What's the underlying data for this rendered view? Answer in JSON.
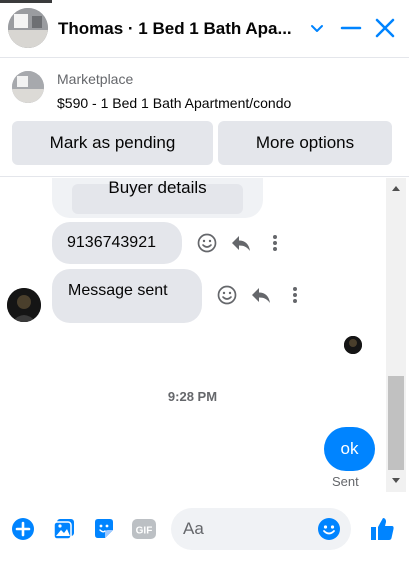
{
  "header": {
    "title": "Thomas · 1 Bed 1 Bath Apa...",
    "icons": [
      "avatar",
      "chevron-down-icon",
      "minimize-icon",
      "close-icon"
    ]
  },
  "listing": {
    "source": "Marketplace",
    "title": "$590 - 1 Bed 1 Bath Apartment/condo",
    "buttons": {
      "mark_pending": "Mark as pending",
      "more_options": "More options"
    }
  },
  "messages": {
    "buyer_details_label": "Buyer details",
    "phone_message": "9136743921",
    "sent_message": "Message sent",
    "timestamp": "9:28 PM",
    "outgoing_message": "ok",
    "outgoing_status": "Sent"
  },
  "composer": {
    "placeholder": "Aa",
    "icons": [
      "add-icon",
      "photo-icon",
      "sticker-icon",
      "gif-icon",
      "emoji-icon",
      "like-icon"
    ],
    "gif_label": "GIF"
  },
  "colors": {
    "accent": "#0084ff",
    "bubble_in": "#e4e6eb",
    "muted_text": "#65676b"
  }
}
